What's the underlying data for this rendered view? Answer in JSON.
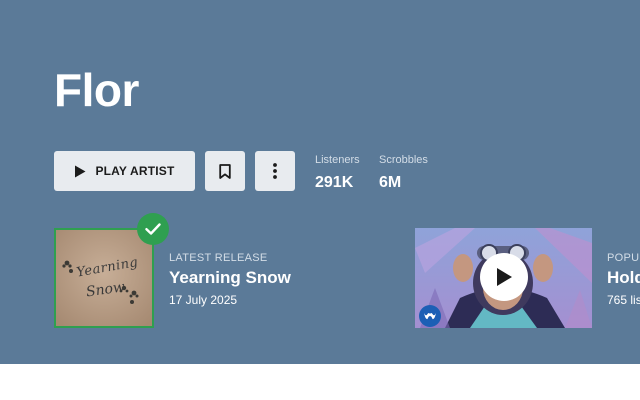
{
  "artist": {
    "name": "Flor"
  },
  "actions": {
    "play_label": "PLAY ARTIST"
  },
  "stats": {
    "listeners": {
      "label": "Listeners",
      "value": "291K"
    },
    "scrobbles": {
      "label": "Scrobbles",
      "value": "6M"
    }
  },
  "latest_release": {
    "label": "LATEST RELEASE",
    "title": "Yearning Snow",
    "date": "17 July 2025",
    "cover_text": "Yearning Snow"
  },
  "popular": {
    "label": "POPUL",
    "title": "Hold",
    "subtitle": "765 lis"
  },
  "icons": {
    "play": "play-icon",
    "bookmark": "bookmark-icon",
    "more": "more-vertical-icon",
    "check": "check-icon",
    "video_play": "play-icon",
    "label": "record-label-icon"
  },
  "colors": {
    "hero_bg": "#5b7a98",
    "button_bg": "#e8ebef",
    "accent_green": "#2f9f50",
    "label_badge": "#1c5fb5"
  }
}
